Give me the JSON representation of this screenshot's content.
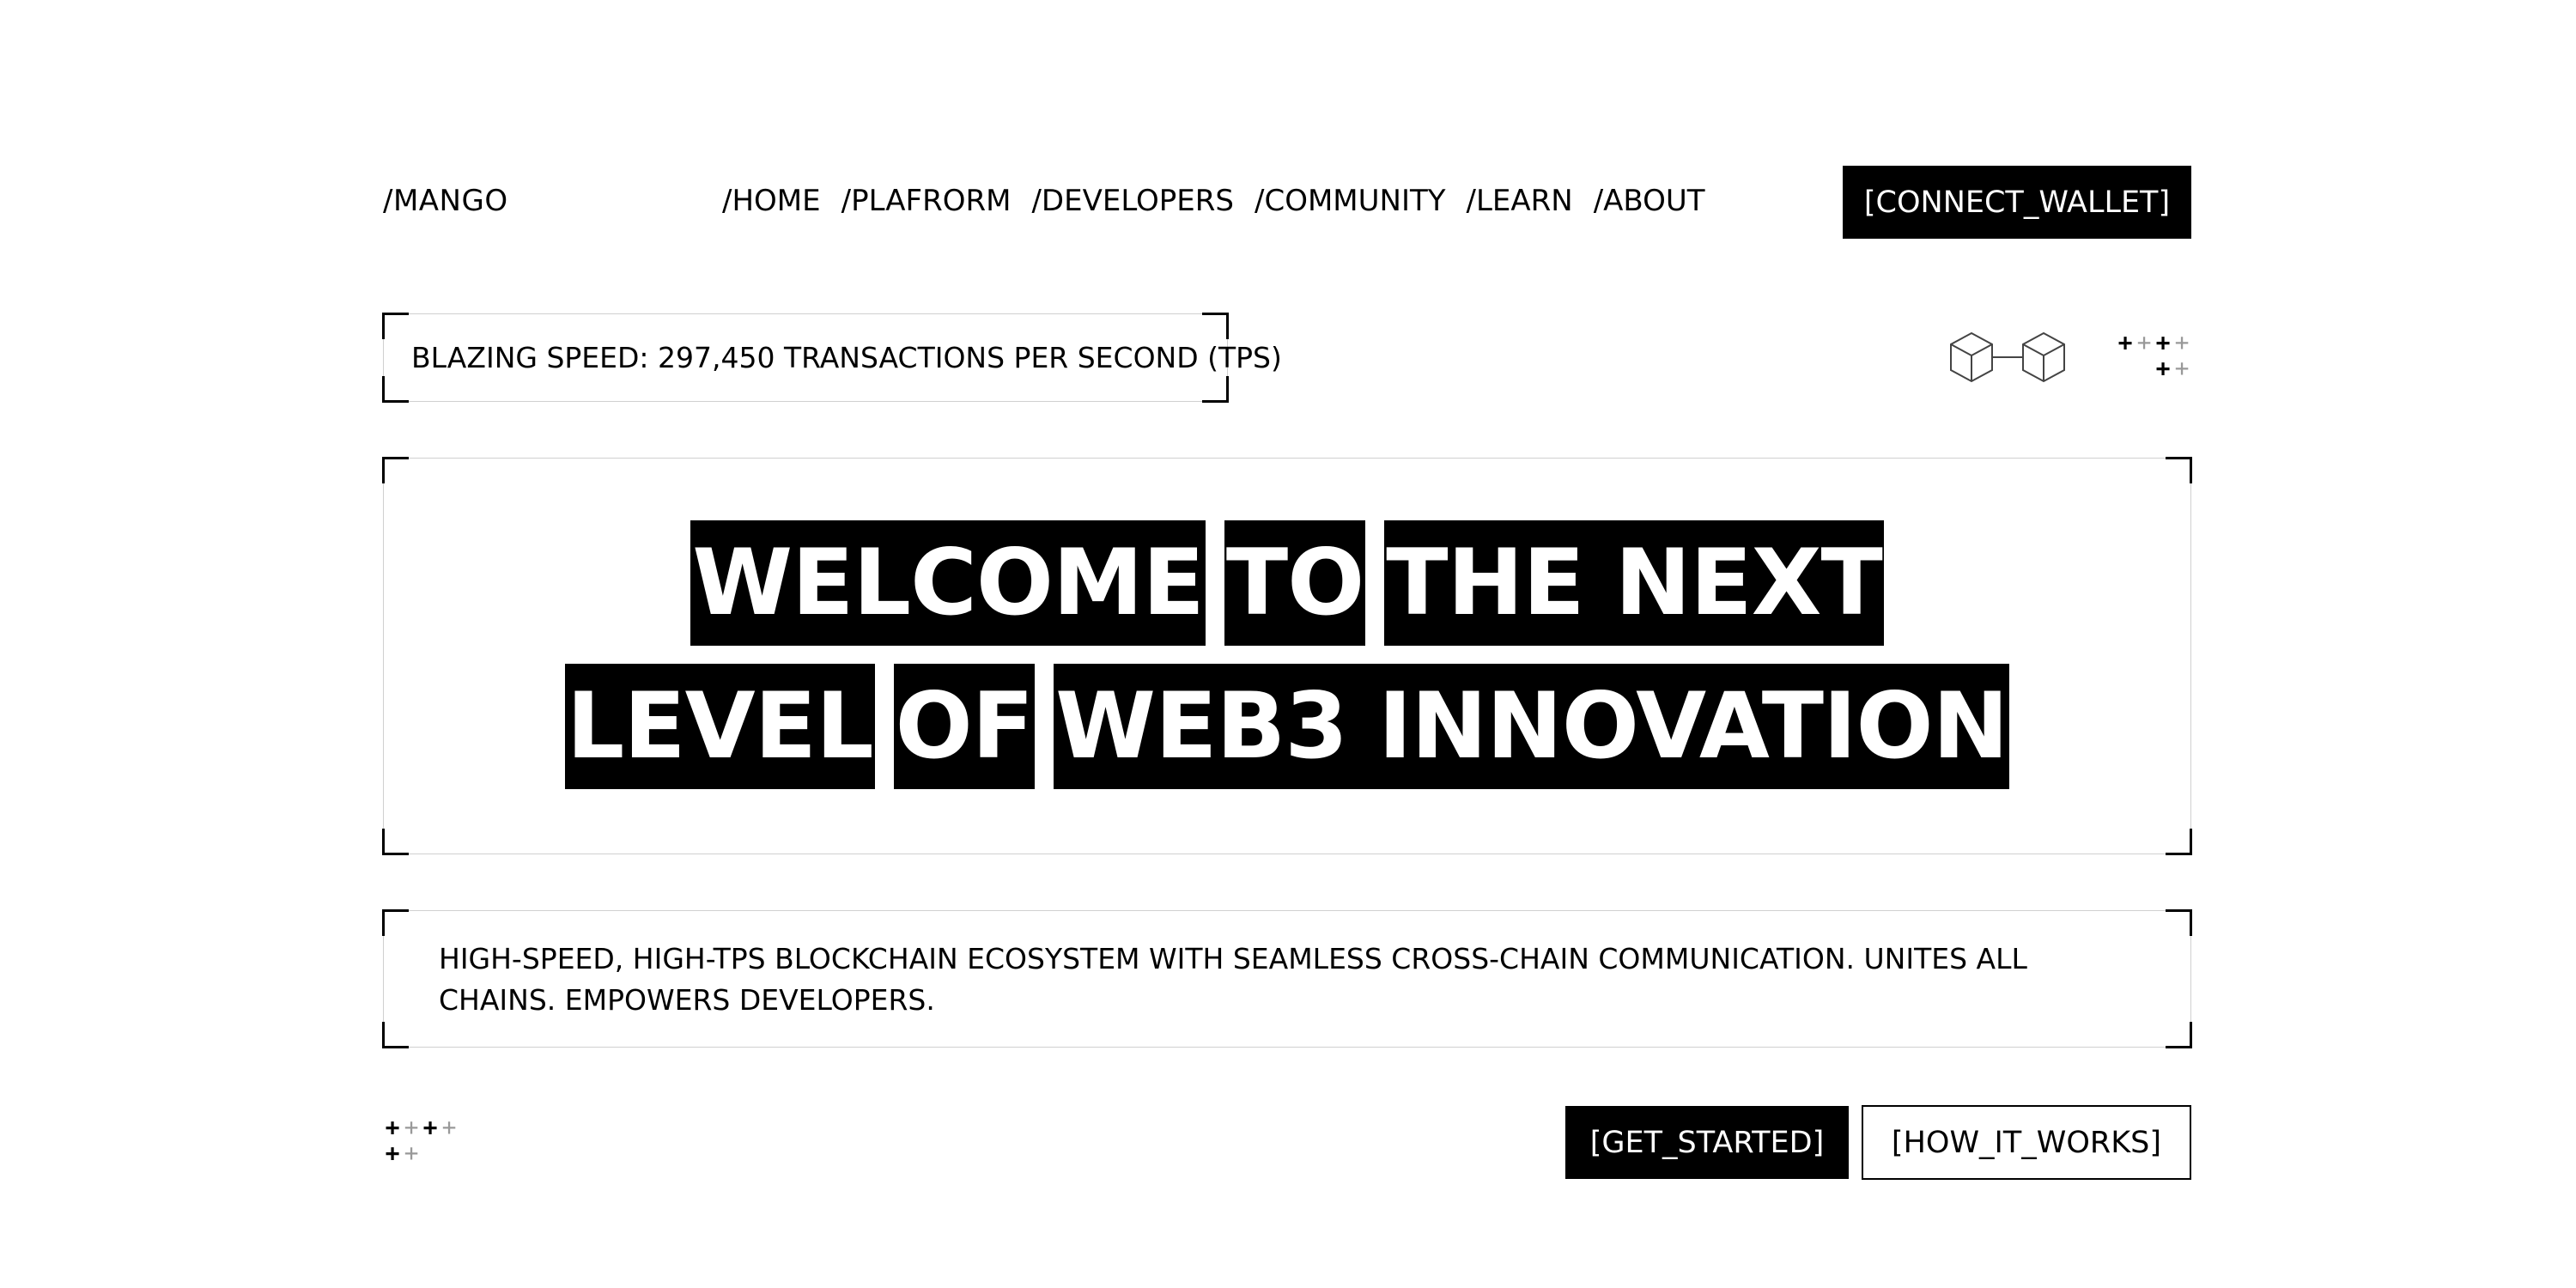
{
  "header": {
    "logo": "/MANGO",
    "nav": [
      "/HOME",
      "/PLAFRORM",
      "/DEVELOPERS",
      "/COMMUNITY",
      "/LEARN",
      "/ABOUT"
    ],
    "connect_label": "[CONNECT_WALLET]"
  },
  "stats": {
    "speed_text": "BLAZING SPEED: 297,450 TRANSACTIONS PER SECOND (TPS)"
  },
  "hero": {
    "line1": [
      "WELCOME",
      "TO",
      "THE NEXT"
    ],
    "line2": [
      "LEVEL",
      "OF",
      "WEB3 INNOVATION"
    ]
  },
  "description": {
    "text": "HIGH-SPEED, HIGH-TPS BLOCKCHAIN ECOSYSTEM WITH SEAMLESS CROSS-CHAIN COMMUNICATION. UNITES ALL CHAINS. EMPOWERS DEVELOPERS."
  },
  "actions": {
    "get_started_label": "[GET_STARTED]",
    "how_it_works_label": "[HOW_IT_WORKS]"
  },
  "icons": {
    "chain": "blockchain-link-icon",
    "plus_cluster": "plus-pattern-icon"
  },
  "colors": {
    "primary": "#000000",
    "background": "#ffffff",
    "muted": "#999999"
  }
}
